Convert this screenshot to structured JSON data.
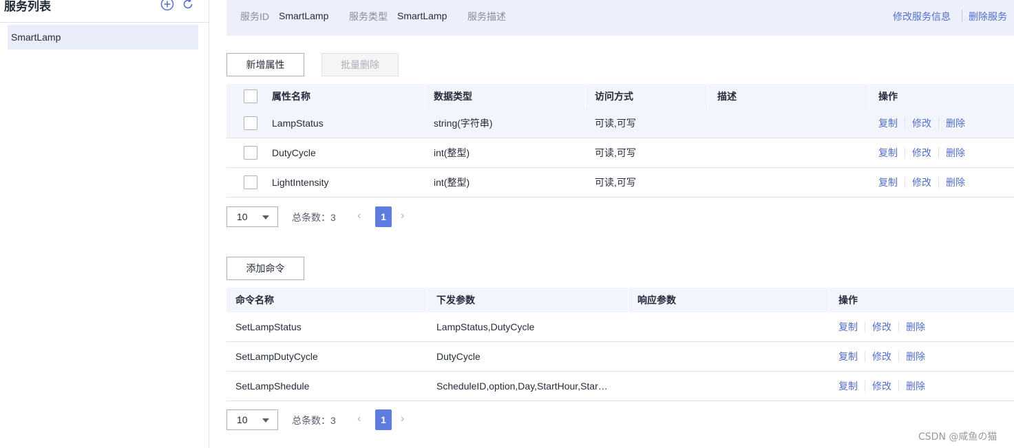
{
  "sidebar": {
    "title": "服务列表",
    "items": [
      {
        "label": "SmartLamp"
      }
    ]
  },
  "service_info": {
    "id_label": "服务ID",
    "id_value": "SmartLamp",
    "type_label": "服务类型",
    "type_value": "SmartLamp",
    "desc_label": "服务描述",
    "desc_value": "",
    "edit_link": "修改服务信息",
    "delete_link": "删除服务"
  },
  "properties": {
    "add_button": "新增属性",
    "batch_delete_button": "批量删除",
    "columns": [
      "属性名称",
      "数据类型",
      "访问方式",
      "描述",
      "操作"
    ],
    "rows": [
      {
        "name": "LampStatus",
        "type": "string(字符串)",
        "access": "可读,可写",
        "desc": ""
      },
      {
        "name": "DutyCycle",
        "type": "int(整型)",
        "access": "可读,可写",
        "desc": ""
      },
      {
        "name": "LightIntensity",
        "type": "int(整型)",
        "access": "可读,可写",
        "desc": ""
      }
    ],
    "pager": {
      "page_size": "10",
      "total": "总条数：3",
      "page": "1"
    }
  },
  "commands": {
    "add_button": "添加命令",
    "columns": [
      "命令名称",
      "下发参数",
      "响应参数",
      "操作"
    ],
    "rows": [
      {
        "name": "SetLampStatus",
        "params": "LampStatus,DutyCycle",
        "response": ""
      },
      {
        "name": "SetLampDutyCycle",
        "params": "DutyCycle",
        "response": ""
      },
      {
        "name": "SetLampShedule",
        "params": "ScheduleID,option,Day,StartHour,Star…",
        "response": ""
      }
    ],
    "pager": {
      "page_size": "10",
      "total": "总条数：3",
      "page": "1"
    }
  },
  "row_ops": {
    "copy": "复制",
    "edit": "修改",
    "delete": "删除"
  },
  "icons": {
    "add": "plus-circle-icon",
    "refresh": "refresh-icon",
    "prev": "‹",
    "next": "›"
  },
  "watermark": "CSDN @咸鱼の猫",
  "colors": {
    "accent": "#5e7ce0",
    "link": "#526ecc",
    "header_bg": "#edf0fa"
  }
}
